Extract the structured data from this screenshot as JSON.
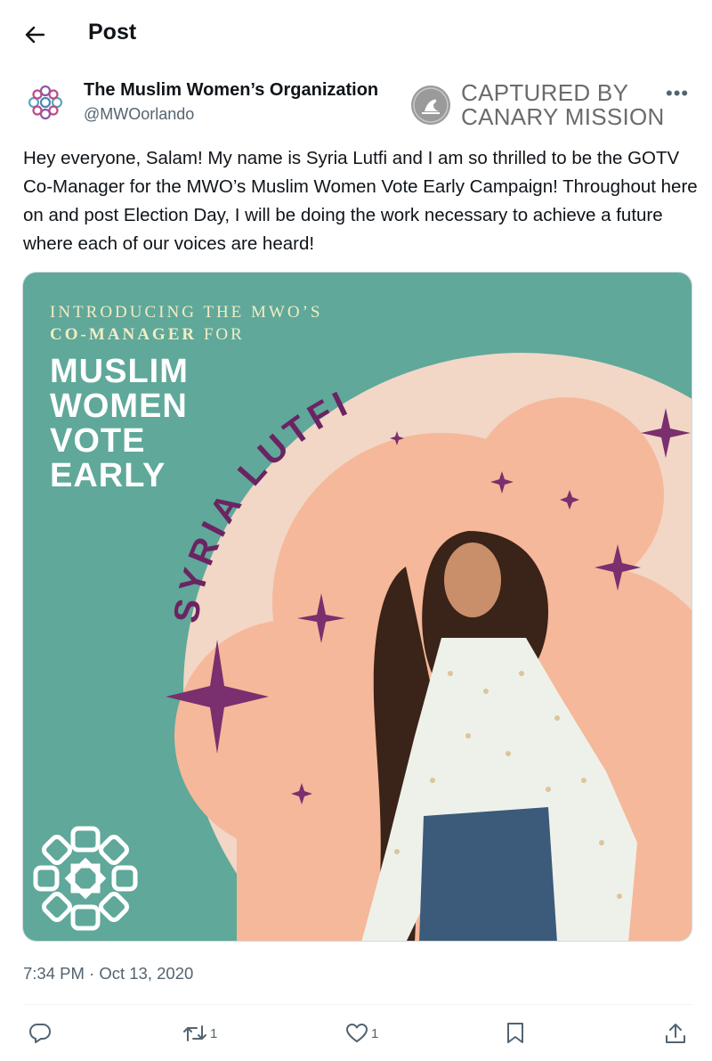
{
  "header": {
    "title": "Post"
  },
  "account": {
    "name": "The Muslim Women’s Organization",
    "handle": "@MWOorlando"
  },
  "watermark": {
    "line1": "CAPTURED BY",
    "line2": "CANARY MISSION"
  },
  "post": {
    "text": "Hey everyone, Salam! My name is Syria Lutfi and I am so thrilled to be the GOTV Co-Manager for the MWO’s Muslim Women Vote Early Campaign! Throughout here on and post Election Day, I will be doing the work necessary to achieve a future where each of our voices are heard!",
    "timestamp": "7:34 PM · Oct 13, 2020"
  },
  "media": {
    "intro_line1": "INTRODUCING THE MWO’S",
    "intro_line2_a": "CO-MANAGER",
    "intro_line2_b": " FOR",
    "headline": [
      "MUSLIM",
      "WOMEN",
      "VOTE",
      "EARLY"
    ],
    "arc_name": "SYRIA LUTFI",
    "colors": {
      "teal": "#5fa89a",
      "peach_light": "#f2d6c6",
      "peach": "#f5b89a",
      "plum": "#7a2f6e",
      "cream": "#f3ecc2"
    }
  },
  "actions": {
    "reply_icon": "reply-icon",
    "repost_count": "1",
    "like_count": "1",
    "bookmark_icon": "bookmark-icon",
    "share_icon": "share-icon"
  }
}
